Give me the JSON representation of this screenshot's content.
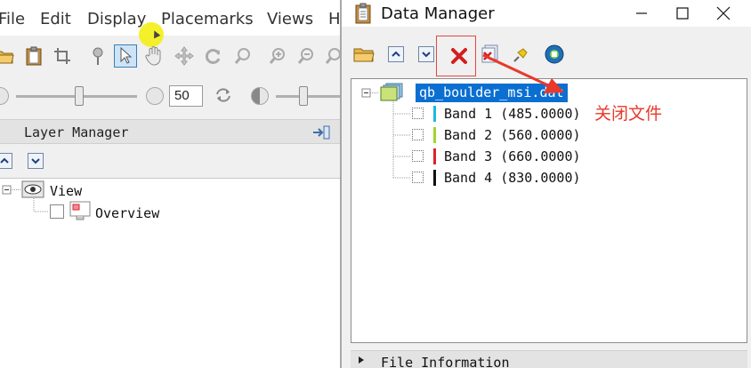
{
  "main_window": {
    "app_icon": "app-icon",
    "menu": [
      "File",
      "Edit",
      "Display",
      "Placemarks",
      "Views",
      "H"
    ],
    "toolbar_icons": [
      "open-folder-icon",
      "clipboard-icon",
      "crop-icon",
      "pin-icon",
      "pointer-icon",
      "hand-icon",
      "move-icon",
      "rotate-icon",
      "zoom-icon",
      "zoom-in-icon",
      "zoom-out-icon"
    ],
    "zoom_value": "50",
    "layer_manager": {
      "title": "Layer Manager",
      "tree": [
        {
          "label": "View",
          "icon": "eye-icon"
        },
        {
          "label": "Overview",
          "icon": "overview-icon"
        }
      ]
    }
  },
  "data_manager": {
    "title": "Data Manager",
    "toolbar_icons": [
      "open-file-icon",
      "move-up-icon",
      "move-down-icon",
      "close-file-icon",
      "close-all-icon",
      "pin-icon",
      "display-icon"
    ],
    "file": {
      "name": "qb_boulder_msi.dat",
      "bands": [
        {
          "label": "Band 1 (485.0000)",
          "color": "#1fb8e0"
        },
        {
          "label": "Band 2 (560.0000)",
          "color": "#9fd62a"
        },
        {
          "label": "Band 3 (660.0000)",
          "color": "#d9252a"
        },
        {
          "label": "Band 4 (830.0000)",
          "color": "#111111"
        }
      ]
    },
    "file_information_label": "File Information"
  },
  "annotation": {
    "text": "关闭文件",
    "color": "#e8392a"
  }
}
